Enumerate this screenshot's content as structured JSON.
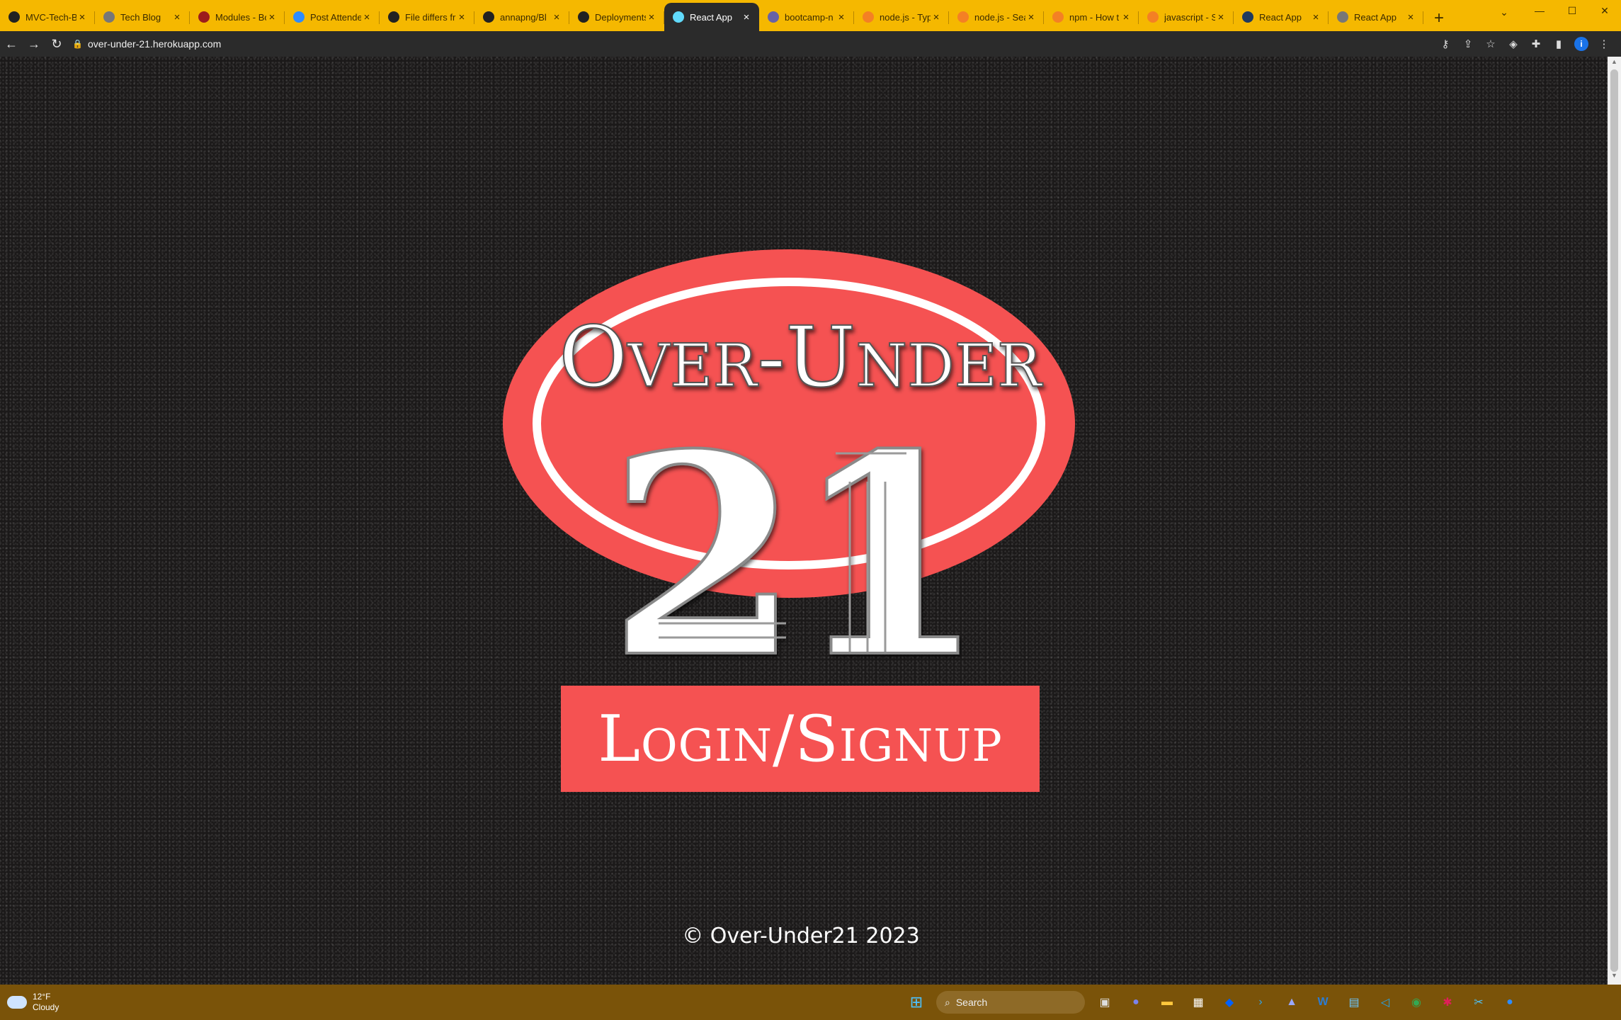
{
  "browser": {
    "tabs": [
      {
        "title": "MVC-Tech-Bl",
        "icon": "github-icon",
        "color": "#222222",
        "active": false
      },
      {
        "title": "Tech Blog",
        "icon": "globe-icon",
        "color": "#777777",
        "active": false
      },
      {
        "title": "Modules - Bo",
        "icon": "bootcamp-icon",
        "color": "#9c1c1c",
        "active": false
      },
      {
        "title": "Post Attende",
        "icon": "zoom-icon",
        "color": "#2d8cff",
        "active": false
      },
      {
        "title": "File differs fr",
        "icon": "github-icon",
        "color": "#222222",
        "active": false
      },
      {
        "title": "annapng/Bl",
        "icon": "github-icon",
        "color": "#222222",
        "active": false
      },
      {
        "title": "Deployments",
        "icon": "github-icon",
        "color": "#222222",
        "active": false
      },
      {
        "title": "React App",
        "icon": "react-icon",
        "color": "#61dafb",
        "active": true
      },
      {
        "title": "bootcamp-n",
        "icon": "heroku-icon",
        "color": "#6762a6",
        "active": false
      },
      {
        "title": "node.js - Typ",
        "icon": "stackoverflow-icon",
        "color": "#f48024",
        "active": false
      },
      {
        "title": "node.js - Sea",
        "icon": "stackoverflow-icon",
        "color": "#f48024",
        "active": false
      },
      {
        "title": "npm - How t",
        "icon": "stackoverflow-icon",
        "color": "#f48024",
        "active": false
      },
      {
        "title": "javascript - S",
        "icon": "stackoverflow-icon",
        "color": "#f48024",
        "active": false
      },
      {
        "title": "React App",
        "icon": "react-icon",
        "color": "#1e3a5f",
        "active": false
      },
      {
        "title": "React App",
        "icon": "globe-icon",
        "color": "#777777",
        "active": false
      }
    ],
    "new_tab_symbol": "+",
    "url": "over-under-21.herokuapp.com"
  },
  "page": {
    "logo": {
      "title": "Over-Under",
      "number": "21",
      "ellipse_color": "#f55252"
    },
    "login_button_label": "Login/Signup",
    "footer": "© Over-Under21 2023",
    "accent_color": "#f55252"
  },
  "taskbar": {
    "weather_temp": "12°F",
    "weather_desc": "Cloudy",
    "search_placeholder": "Search"
  }
}
